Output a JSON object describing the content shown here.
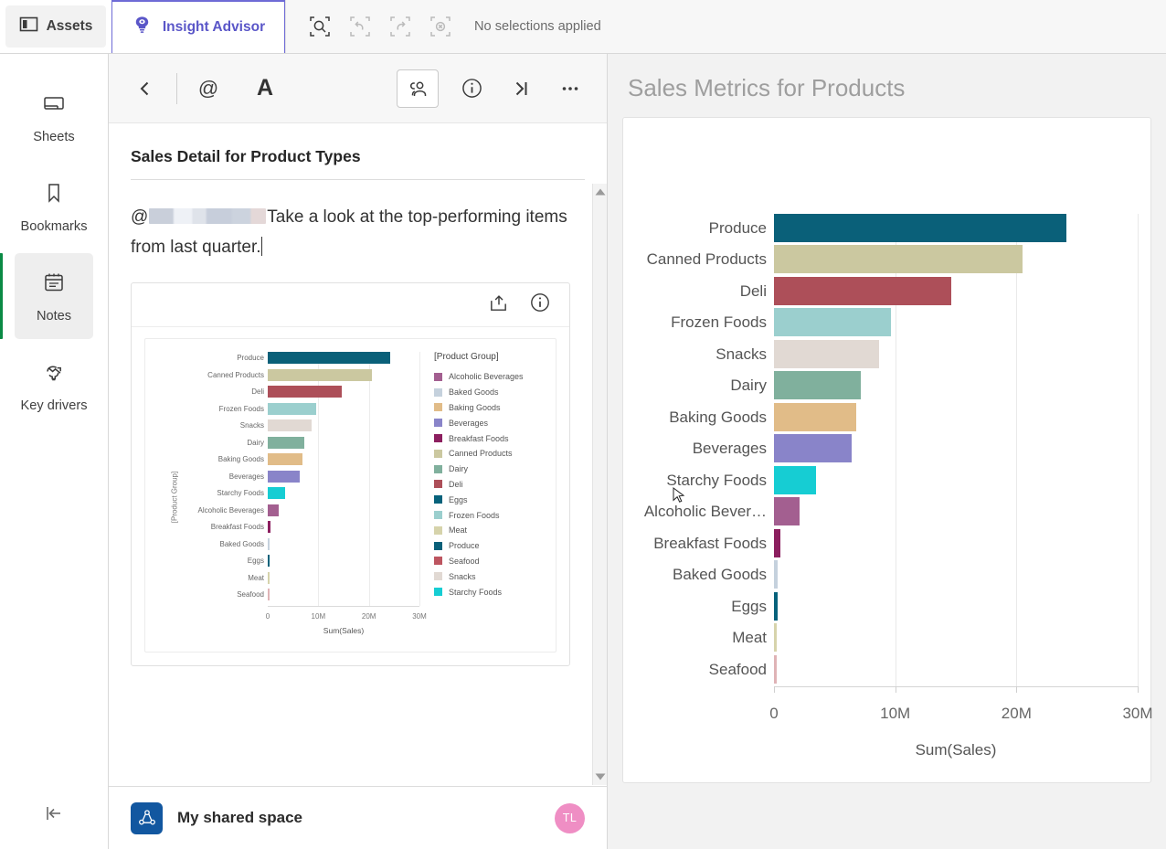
{
  "topbar": {
    "assets_label": "Assets",
    "assets_icon": "panel-icon",
    "insight_advisor_label": "Insight Advisor",
    "insight_advisor_icon": "insight-bulb-icon",
    "selection_search_icon": "selection-search-icon",
    "undo_icon": "selection-undo-icon",
    "redo_icon": "selection-redo-icon",
    "clear_icon": "selection-clear-icon",
    "selections_status": "No selections applied"
  },
  "rail": {
    "items": [
      {
        "label": "Sheets",
        "icon": "sheets-icon",
        "active": false
      },
      {
        "label": "Bookmarks",
        "icon": "bookmark-icon",
        "active": false
      },
      {
        "label": "Notes",
        "icon": "notes-icon",
        "active": true
      },
      {
        "label": "Key drivers",
        "icon": "key-drivers-icon",
        "active": false
      }
    ],
    "collapse_icon": "collapse-left-icon"
  },
  "notes": {
    "toolbar": {
      "back_icon": "chevron-left-icon",
      "mention_icon": "at-mention-icon",
      "format_icon": "text-format-icon",
      "people_icon": "people-share-icon",
      "info_icon": "info-icon",
      "expand_icon": "expand-right-icon",
      "more_icon": "more-options-icon"
    },
    "title": "Sales Detail for Product Types",
    "text_prefix": "@",
    "mention_redacted": true,
    "text_body": "Take a look at the top-performing items from last quarter.",
    "embed": {
      "share_icon": "share-export-icon",
      "info_icon": "info-icon"
    },
    "scrollbar": {
      "up_icon": "scroll-up-arrow",
      "down_icon": "scroll-down-arrow"
    }
  },
  "space_bar": {
    "icon": "shared-space-icon",
    "name": "My shared space",
    "avatar_initials": "TL",
    "avatar_color": "#ef8ec4",
    "icon_color": "#1257a0"
  },
  "right_panel": {
    "title": "Sales Metrics for Products"
  },
  "colors": {
    "accent_purple": "#5a56c8",
    "active_green": "#0a8a45"
  },
  "chart_data": [
    {
      "id": "main-chart",
      "type": "bar",
      "orientation": "horizontal",
      "title": "Sales Metrics for Products",
      "xlabel": "Sum(Sales)",
      "ylabel": "",
      "xlim": [
        0,
        30000000
      ],
      "xticks": [
        0,
        10000000,
        20000000,
        30000000
      ],
      "xtick_labels": [
        "0",
        "10M",
        "20M",
        "30M"
      ],
      "grid": true,
      "legend": false,
      "categories": [
        "Produce",
        "Canned Products",
        "Deli",
        "Frozen Foods",
        "Snacks",
        "Dairy",
        "Baking Goods",
        "Beverages",
        "Starchy Foods",
        "Alcoholic Bever…",
        "Breakfast Foods",
        "Baked Goods",
        "Eggs",
        "Meat",
        "Seafood"
      ],
      "values": [
        24150000,
        20520000,
        14660000,
        9630000,
        8700000,
        7190000,
        6780000,
        6400000,
        3480000,
        2110000,
        520000,
        300000,
        280000,
        60000,
        40000
      ],
      "colors": [
        "#0a6079",
        "#cbc8a0",
        "#ad4f59",
        "#9bcfce",
        "#e1d9d3",
        "#80b09d",
        "#e1bc88",
        "#8984c9",
        "#16cdd3",
        "#a35f90",
        "#8c1f5f",
        "#c5d1dd",
        "#07627b",
        "#d6d3ab",
        "#dfb3b6"
      ]
    },
    {
      "id": "embedded-chart",
      "type": "bar",
      "orientation": "horizontal",
      "title": "",
      "xlabel": "Sum(Sales)",
      "ylabel": "[Product Group]",
      "xlim": [
        0,
        30000000
      ],
      "xticks": [
        0,
        10000000,
        20000000,
        30000000
      ],
      "xtick_labels": [
        "0",
        "10M",
        "20M",
        "30M"
      ],
      "grid": true,
      "legend": true,
      "legend_position": "right",
      "legend_title": "[Product Group]",
      "legend_entries": [
        {
          "label": "Alcoholic Beverages",
          "color": "#a35f90"
        },
        {
          "label": "Baked Goods",
          "color": "#c5d1dd"
        },
        {
          "label": "Baking Goods",
          "color": "#e1bc88"
        },
        {
          "label": "Beverages",
          "color": "#8984c9"
        },
        {
          "label": "Breakfast Foods",
          "color": "#8c1f5f"
        },
        {
          "label": "Canned Products",
          "color": "#cbc8a0"
        },
        {
          "label": "Dairy",
          "color": "#80b09d"
        },
        {
          "label": "Deli",
          "color": "#ad4f59"
        },
        {
          "label": "Eggs",
          "color": "#07627b"
        },
        {
          "label": "Frozen Foods",
          "color": "#9bcfce"
        },
        {
          "label": "Meat",
          "color": "#d6d3ab"
        },
        {
          "label": "Produce",
          "color": "#0a6079"
        },
        {
          "label": "Seafood",
          "color": "#bd5560"
        },
        {
          "label": "Snacks",
          "color": "#e1d9d3"
        },
        {
          "label": "Starchy Foods",
          "color": "#16cdd3"
        }
      ],
      "categories": [
        "Produce",
        "Canned Products",
        "Deli",
        "Frozen Foods",
        "Snacks",
        "Dairy",
        "Baking Goods",
        "Beverages",
        "Starchy Foods",
        "Alcoholic Beverages",
        "Breakfast Foods",
        "Baked Goods",
        "Eggs",
        "Meat",
        "Seafood"
      ],
      "values": [
        24150000,
        20520000,
        14660000,
        9630000,
        8700000,
        7190000,
        6780000,
        6400000,
        3480000,
        2110000,
        520000,
        300000,
        280000,
        60000,
        40000
      ],
      "colors": [
        "#0a6079",
        "#cbc8a0",
        "#ad4f59",
        "#9bcfce",
        "#e1d9d3",
        "#80b09d",
        "#e1bc88",
        "#8984c9",
        "#16cdd3",
        "#a35f90",
        "#8c1f5f",
        "#c5d1dd",
        "#07627b",
        "#d6d3ab",
        "#dfb3b6"
      ]
    }
  ]
}
